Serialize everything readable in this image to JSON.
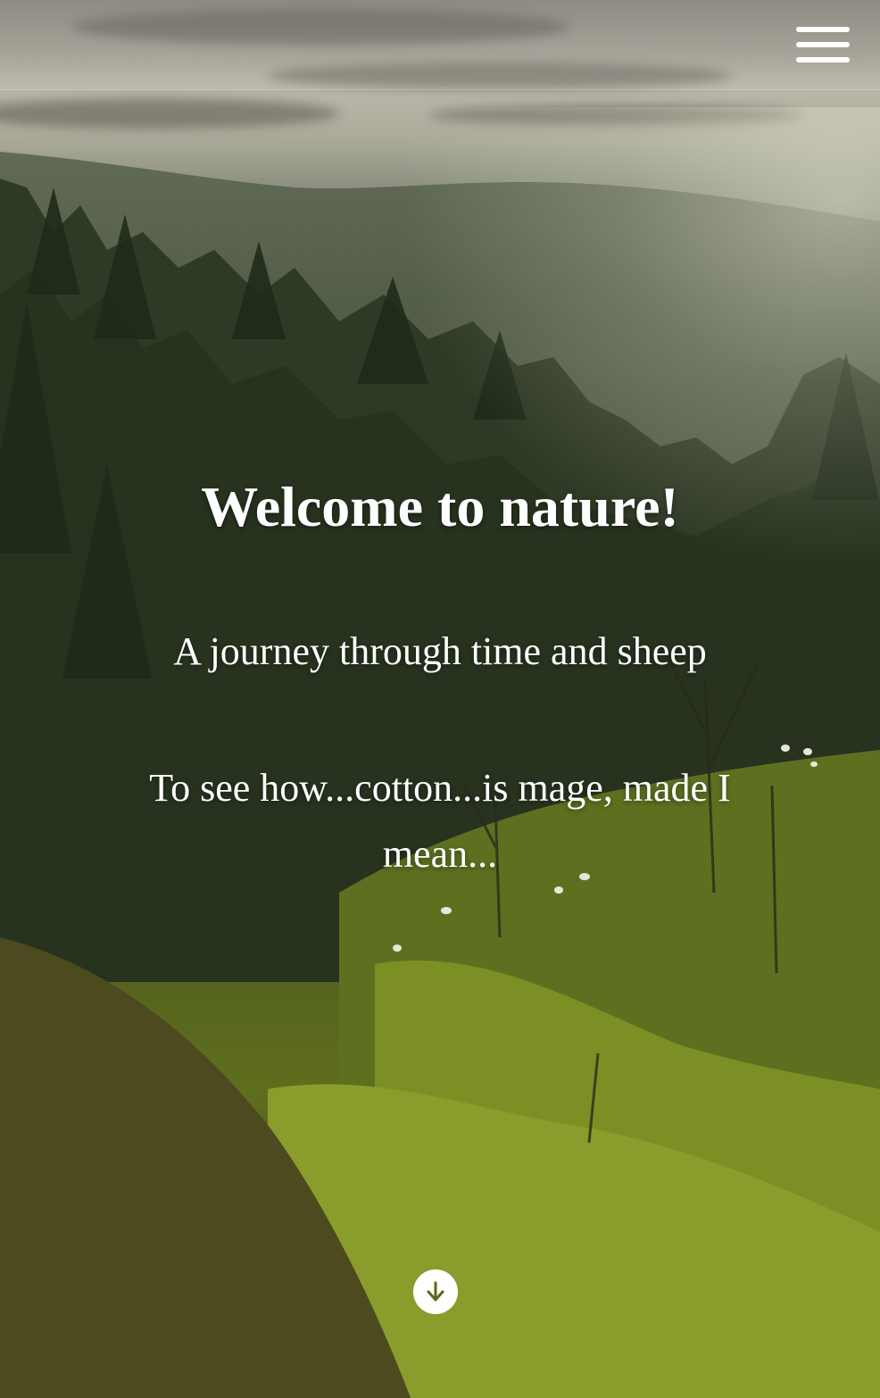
{
  "header": {
    "menu_icon": "hamburger-menu-icon"
  },
  "hero": {
    "title": "Welcome to nature!",
    "subtitle": "A journey through time and sheep",
    "tagline": "To see how...cotton...is mage, made I mean...",
    "scroll_icon": "arrow-down-circle-icon"
  },
  "colors": {
    "text": "#ffffff",
    "meadow": "#8fa22a",
    "forest": "#34402b",
    "sky": "#b9b6a8"
  }
}
